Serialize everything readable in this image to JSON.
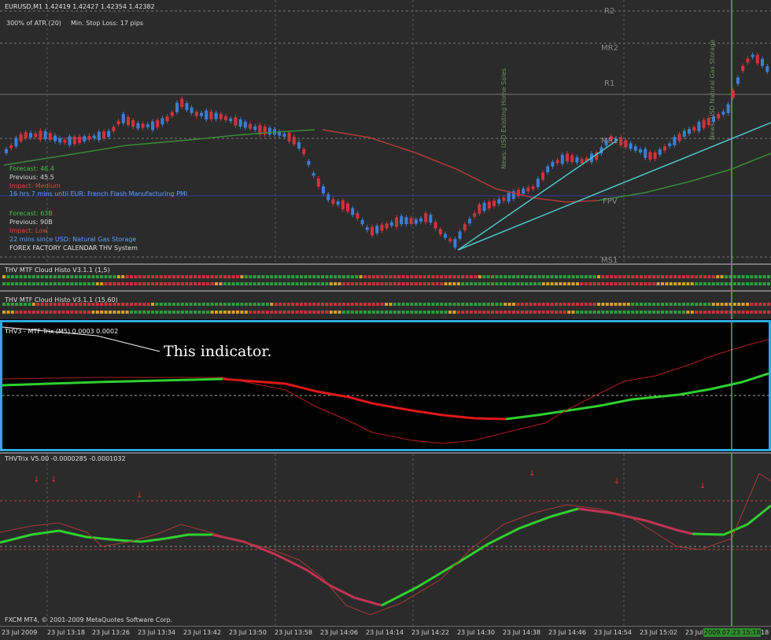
{
  "colors": {
    "panel_bg": "#2b2b2b",
    "trix_bg": "#000000",
    "grid": "#555555",
    "bull": "#3a7fd5",
    "bear": "#d0333c",
    "trend_up": "#2fd02f",
    "trend_down": "#e01818",
    "ma": "#3a8a3a",
    "cyan_line": "#4fc6c6",
    "time_highlight": "#2e8b2e",
    "box_orange": "#d7a12a",
    "selection_border": "#2fa9e0"
  },
  "main_chart": {
    "symbol_header": "EURUSD,M1  1.42419 1.42427 1.42354 1.42382",
    "atr_info": "300% of ATR (20)",
    "stop_loss_info": "Min. Stop Loss:   17 pips",
    "pivot_labels": [
      "R2",
      "MR2",
      "R1",
      "MR1",
      "FPV",
      "MS1"
    ],
    "news_block_1": {
      "forecast": "Forecast: 46.4",
      "previous": "Previous: 45.5",
      "impact": "Impact: Medium",
      "countdown": "16 hrs 7 mins until EUR: French Flash Manufacturing PMI"
    },
    "news_block_2": {
      "forecast": "Forecast: 63B",
      "previous": "Previous: 90B",
      "impact": "Impact: Low",
      "since": "22 mins since USD: Natural Gas Storage",
      "system": "FOREX FACTORY CALENDAR THV System"
    },
    "vertical_news_1": "News: USD Existing Home Sales",
    "vertical_news_2": "News: USD Natural Gas Storage"
  },
  "cloud_histo_1": {
    "title": "THV MTF Cloud Histo V3.1.1 (1,5)"
  },
  "cloud_histo_2": {
    "title": "THV MTF Cloud Histo V3.1.1 (15,60)"
  },
  "trix_pane": {
    "title": "THV3 - MTF Trix (M5) 0.0003 0.0002",
    "annotation": "This indicator."
  },
  "thv_trix_pane": {
    "title": "THVTrix V5.00 -0.0000285 -0.0001032",
    "copyright": "FXCM MT4, © 2001-2009 MetaQuotes Software Corp."
  },
  "time_axis": {
    "labels": [
      "23 Jul 2009",
      "23 Jul 13:18",
      "23 Jul 13:26",
      "23 Jul 13:34",
      "23 Jul 13:42",
      "23 Jul 13:50",
      "23 Jul 13:58",
      "23 Jul 14:06",
      "23 Jul 14:14",
      "23 Jul 14:22",
      "23 Jul 14:30",
      "23 Jul 14:38",
      "23 Jul 14:46",
      "23 Jul 14:54",
      "23 Jul 15:02",
      "23 Jul 15:10"
    ],
    "cursor_label": "2009.07.23 15:18",
    "edge_fragment": "18"
  }
}
